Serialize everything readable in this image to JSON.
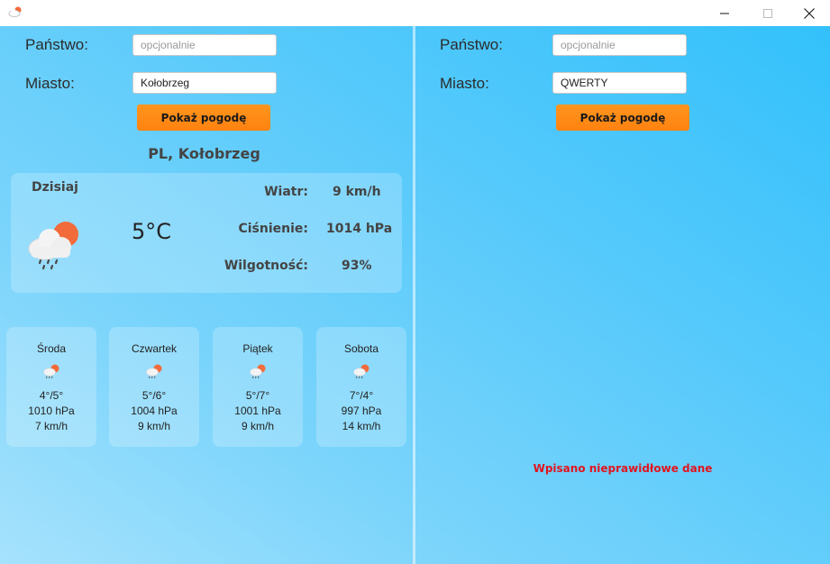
{
  "left": {
    "country_label": "Państwo:",
    "country_value": "",
    "country_placeholder": "opcjonalnie",
    "city_label": "Miasto:",
    "city_value": "Kołobrzeg",
    "show_button": "Pokaż pogodę",
    "location_title": "PL, Kołobrzeg",
    "today": {
      "label": "Dzisiaj",
      "icon": "cloud-rain-sun-icon",
      "temperature": "5°C",
      "wind_label": "Wiatr:",
      "wind_value": "9 km/h",
      "pressure_label": "Ciśnienie:",
      "pressure_value": "1014 hPa",
      "humidity_label": "Wilgotność:",
      "humidity_value": "93%"
    },
    "forecast": [
      {
        "day": "Środa",
        "icon": "cloud-rain-sun-icon",
        "temp": "4°/5°",
        "pressure": "1010 hPa",
        "wind": "7 km/h"
      },
      {
        "day": "Czwartek",
        "icon": "cloud-rain-sun-icon",
        "temp": "5°/6°",
        "pressure": "1004 hPa",
        "wind": "9 km/h"
      },
      {
        "day": "Piątek",
        "icon": "cloud-rain-sun-icon",
        "temp": "5°/7°",
        "pressure": "1001 hPa",
        "wind": "9 km/h"
      },
      {
        "day": "Sobota",
        "icon": "cloud-rain-sun-icon",
        "temp": "7°/4°",
        "pressure": "997 hPa",
        "wind": "14 km/h"
      }
    ]
  },
  "right": {
    "country_label": "Państwo:",
    "country_value": "",
    "country_placeholder": "opcjonalnie",
    "city_label": "Miasto:",
    "city_value": "QWERTY",
    "show_button": "Pokaż pogodę",
    "error_message": "Wpisano nieprawidłowe dane"
  },
  "colors": {
    "accent_button": "#ff8a15",
    "error": "#e2141e",
    "background_start": "#a6e2fd",
    "background_end": "#33c1fb"
  }
}
